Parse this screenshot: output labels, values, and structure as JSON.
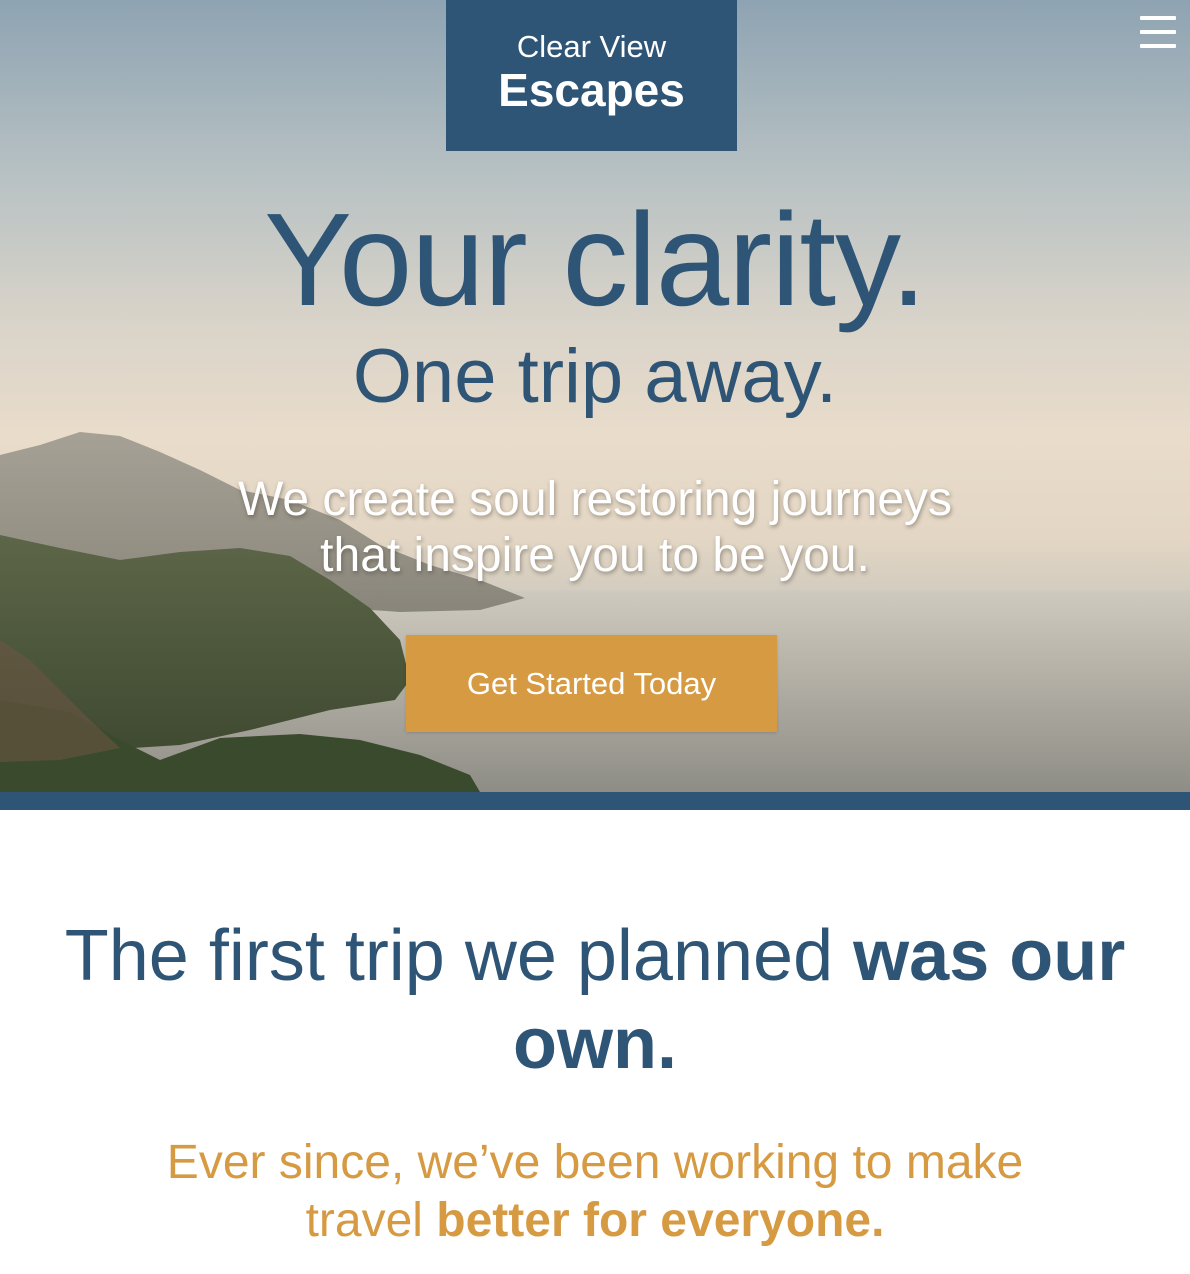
{
  "brand": {
    "line1": "Clear View",
    "line2": "Escapes",
    "color": "#2f5576"
  },
  "header": {
    "menu_icon": "hamburger-menu-icon"
  },
  "hero": {
    "headline": "Your clarity.",
    "subheadline": "One trip away.",
    "tagline_line1": "We create soul restoring journeys",
    "tagline_line2": "that inspire you to be you.",
    "cta_label": "Get Started Today",
    "cta_color": "#d69a42"
  },
  "story": {
    "heading_light": "The first trip we planned",
    "heading_bold": "was our own.",
    "sub_light": "Ever since, we’ve been working to make travel",
    "sub_bold": "better for everyone."
  }
}
